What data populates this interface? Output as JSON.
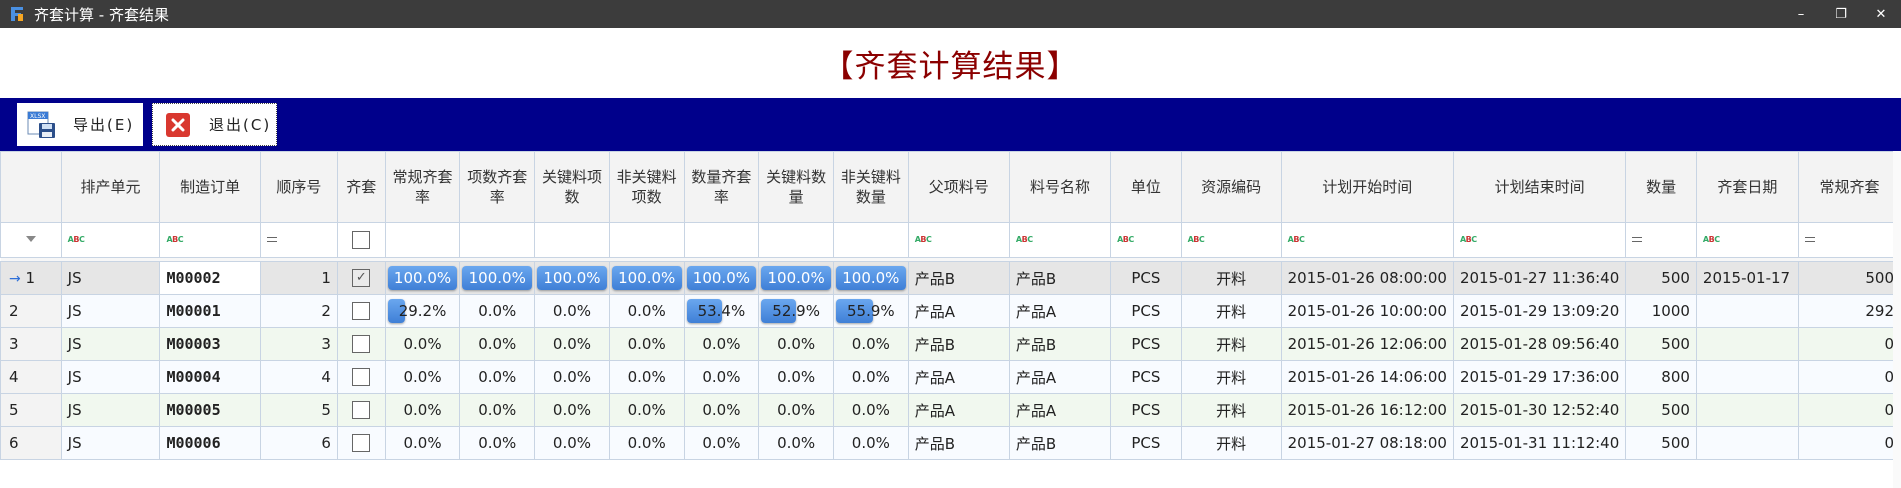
{
  "window": {
    "title": "齐套计算 - 齐套结果",
    "minimize": "–",
    "restore": "❐",
    "close": "✕"
  },
  "header": {
    "title": "【齐套计算结果】"
  },
  "toolbar": {
    "export_label": "导出(E)",
    "exit_label": "退出(C)",
    "export_icon": "excel-export-icon",
    "exit_icon": "exit-icon"
  },
  "table": {
    "columns": [
      "排产单元",
      "制造订单",
      "顺序号",
      "齐套",
      "常规齐套率",
      "项数齐套率",
      "关键料项数",
      "非关键料项数",
      "数量齐套率",
      "关键料数量",
      "非关键料数量",
      "父项料号",
      "料号名称",
      "单位",
      "资源编码",
      "计划开始时间",
      "计划结束时间",
      "数量",
      "齐套日期",
      "常规齐套"
    ],
    "rows": [
      {
        "no": "1",
        "unit": "JS",
        "order": "M00002",
        "seq": "1",
        "kit": true,
        "p1": "100.0%",
        "p2": "100.0%",
        "p3": "100.0%",
        "p4": "100.0%",
        "p5": "100.0%",
        "p6": "100.0%",
        "p7": "100.0%",
        "f1": 1,
        "f2": 1,
        "f3": 1,
        "f4": 1,
        "f5": 1,
        "f6": 1,
        "f7": 1,
        "parent": "产品B",
        "name": "产品B",
        "uom": "PCS",
        "res": "开料",
        "start": "2015-01-26 08:00:00",
        "end": "2015-01-27 11:36:40",
        "qty": "500",
        "kitdate": "2015-01-17",
        "regular": "500"
      },
      {
        "no": "2",
        "unit": "JS",
        "order": "M00001",
        "seq": "2",
        "kit": false,
        "p1": "29.2%",
        "p2": "0.0%",
        "p3": "0.0%",
        "p4": "0.0%",
        "p5": "53.4%",
        "p6": "52.9%",
        "p7": "55.9%",
        "f1": 0.292,
        "f2": 0,
        "f3": 0,
        "f4": 0,
        "f5": 0.534,
        "f6": 0.529,
        "f7": 0.559,
        "parent": "产品A",
        "name": "产品A",
        "uom": "PCS",
        "res": "开料",
        "start": "2015-01-26 10:00:00",
        "end": "2015-01-29 13:09:20",
        "qty": "1000",
        "kitdate": "",
        "regular": "292"
      },
      {
        "no": "3",
        "unit": "JS",
        "order": "M00003",
        "seq": "3",
        "kit": false,
        "p1": "0.0%",
        "p2": "0.0%",
        "p3": "0.0%",
        "p4": "0.0%",
        "p5": "0.0%",
        "p6": "0.0%",
        "p7": "0.0%",
        "f1": 0,
        "f2": 0,
        "f3": 0,
        "f4": 0,
        "f5": 0,
        "f6": 0,
        "f7": 0,
        "parent": "产品B",
        "name": "产品B",
        "uom": "PCS",
        "res": "开料",
        "start": "2015-01-26 12:06:00",
        "end": "2015-01-28 09:56:40",
        "qty": "500",
        "kitdate": "",
        "regular": "0"
      },
      {
        "no": "4",
        "unit": "JS",
        "order": "M00004",
        "seq": "4",
        "kit": false,
        "p1": "0.0%",
        "p2": "0.0%",
        "p3": "0.0%",
        "p4": "0.0%",
        "p5": "0.0%",
        "p6": "0.0%",
        "p7": "0.0%",
        "f1": 0,
        "f2": 0,
        "f3": 0,
        "f4": 0,
        "f5": 0,
        "f6": 0,
        "f7": 0,
        "parent": "产品A",
        "name": "产品A",
        "uom": "PCS",
        "res": "开料",
        "start": "2015-01-26 14:06:00",
        "end": "2015-01-29 17:36:00",
        "qty": "800",
        "kitdate": "",
        "regular": "0"
      },
      {
        "no": "5",
        "unit": "JS",
        "order": "M00005",
        "seq": "5",
        "kit": false,
        "p1": "0.0%",
        "p2": "0.0%",
        "p3": "0.0%",
        "p4": "0.0%",
        "p5": "0.0%",
        "p6": "0.0%",
        "p7": "0.0%",
        "f1": 0,
        "f2": 0,
        "f3": 0,
        "f4": 0,
        "f5": 0,
        "f6": 0,
        "f7": 0,
        "parent": "产品A",
        "name": "产品A",
        "uom": "PCS",
        "res": "开料",
        "start": "2015-01-26 16:12:00",
        "end": "2015-01-30 12:52:40",
        "qty": "500",
        "kitdate": "",
        "regular": "0"
      },
      {
        "no": "6",
        "unit": "JS",
        "order": "M00006",
        "seq": "6",
        "kit": false,
        "p1": "0.0%",
        "p2": "0.0%",
        "p3": "0.0%",
        "p4": "0.0%",
        "p5": "0.0%",
        "p6": "0.0%",
        "p7": "0.0%",
        "f1": 0,
        "f2": 0,
        "f3": 0,
        "f4": 0,
        "f5": 0,
        "f6": 0,
        "f7": 0,
        "parent": "产品B",
        "name": "产品B",
        "uom": "PCS",
        "res": "开料",
        "start": "2015-01-27 08:18:00",
        "end": "2015-01-31 11:12:40",
        "qty": "500",
        "kitdate": "",
        "regular": "0"
      }
    ]
  },
  "colors": {
    "title": "#8b0000",
    "toolbar": "#00008b",
    "bar": "#4a8be0"
  }
}
